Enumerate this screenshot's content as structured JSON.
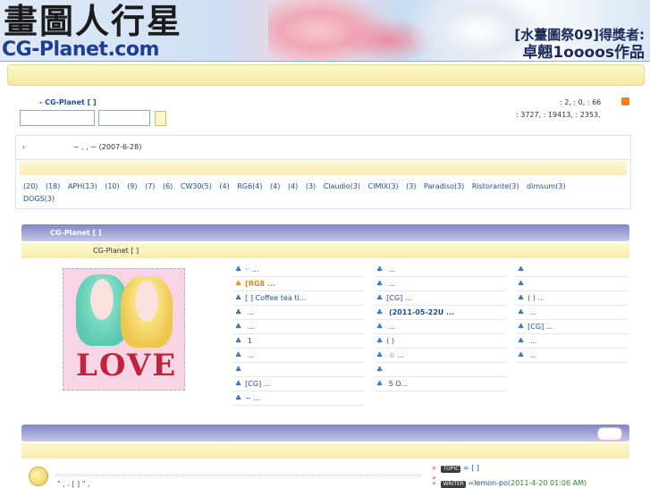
{
  "header": {
    "logo_cjk": "畫圖人行星",
    "logo_en": "CG-Planet.com",
    "award_line1": "[水薹圖祭09]得獎者:",
    "award_line2": "卓翹1oooos作品"
  },
  "topbar": {
    "nav_text": "· · · · · · · · · ·"
  },
  "site": {
    "title_link": "- CG-Planet [ ]"
  },
  "search": {
    "input1_value": "",
    "input2_value": ""
  },
  "stats": {
    "line1": ": 2,  : 0,   : 66",
    "line2": ": 3727,  : 19413,  : 2353,"
  },
  "announcement": {
    "arrow": "›",
    "text": "~   ,   ,  ~  (2007-6-28)"
  },
  "tags": {
    "row1": [
      "(20)",
      "(18)",
      "APH(13)",
      "(10)",
      "(9)",
      "(7)",
      "(6)",
      "CW30(5)",
      "(4)",
      "RG6(4)",
      "(4)",
      "(4)",
      "(3)",
      "Claudio(3)",
      "CIMIX(3)",
      "(3)",
      "Paradiso(3)",
      "Ristorante(3)",
      "dimsum(3)"
    ],
    "row2": [
      "DOGS(3)"
    ]
  },
  "section1": {
    "title": "CG-Planet [ ]",
    "subtitle": "CG-Planet [ ]"
  },
  "featured_image": {
    "caption": "LOVE"
  },
  "list_col1": [
    {
      "text": "·· ...",
      "hot": false
    },
    {
      "text": "[RG8        ...",
      "hot": true
    },
    {
      "text": "[ ] Coffee tea ti...",
      "hot": false
    },
    {
      "text": "       ...",
      "hot": false
    },
    {
      "text": "       ...",
      "hot": false
    },
    {
      "text": "  1",
      "hot": false
    },
    {
      "text": "         ...",
      "hot": false
    },
    {
      "text": "",
      "hot": false
    },
    {
      "text": "[CG]      ...",
      "hot": false
    },
    {
      "text": "~     ...",
      "hot": false
    }
  ],
  "list_col2": [
    {
      "text": "         ...",
      "hot": false
    },
    {
      "text": "         ...",
      "hot": false
    },
    {
      "text": "[CG]      ...",
      "hot": false
    },
    {
      "text": "     (2011-05-22U ...",
      "hot": false
    },
    {
      "text": "         ...",
      "hot": false
    },
    {
      "text": "( )",
      "hot": false
    },
    {
      "text": "     ☆   ...",
      "hot": false
    },
    {
      "text": "",
      "hot": false
    },
    {
      "text": "  5    O...",
      "hot": false
    }
  ],
  "list_col3": [
    {
      "text": "",
      "hot": false
    },
    {
      "text": "",
      "hot": false
    },
    {
      "text": "( ) ...",
      "hot": false
    },
    {
      "text": "       ...",
      "hot": false
    },
    {
      "text": "[CG]      ...",
      "hot": false
    },
    {
      "text": "       ...",
      "hot": false
    },
    {
      "text": "       ...",
      "hot": false
    }
  ],
  "bottom": {
    "text": "\"    ,    .   [ ]   \"   ,",
    "topic_label": "TOPIC",
    "topic_value": "= [ ]",
    "writer_label": "WRITER",
    "writer_value": "=lemon-po",
    "writer_date": "(2011-4-20 01:06 AM)",
    "bullet1": "»",
    "bullet2": "»",
    "bullet3": "»"
  },
  "colors": {
    "link": "#1a4fa0",
    "section_bar": "#7f86c6",
    "hot": "#e08a00"
  }
}
